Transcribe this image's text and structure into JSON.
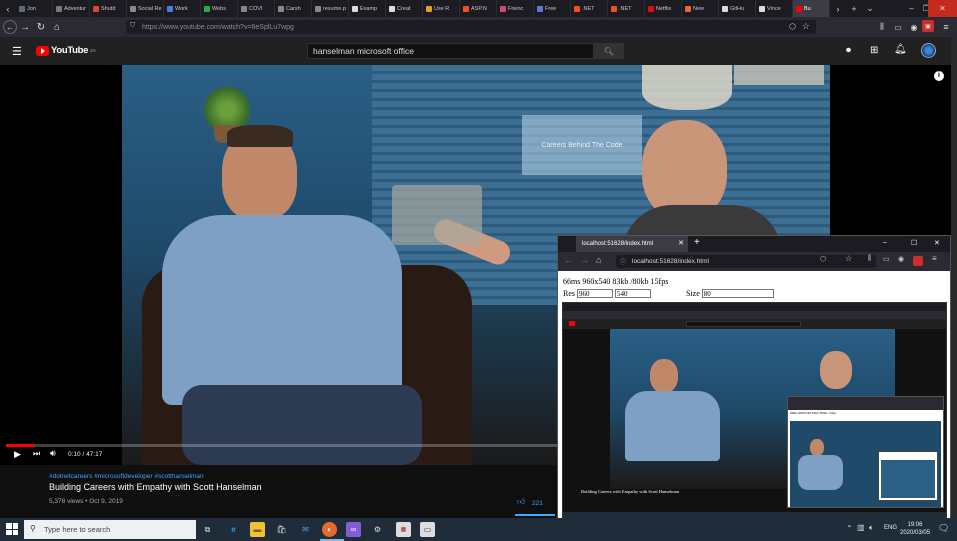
{
  "browser": {
    "tabs": [
      {
        "label": "Jon",
        "color": "#5b6b7a"
      },
      {
        "label": "Adventur",
        "color": "#7a7a7a"
      },
      {
        "label": "Shutd",
        "color": "#d64a2a"
      },
      {
        "label": "Social Re",
        "color": "#8a8a8a"
      },
      {
        "label": "Work",
        "color": "#4a7ed8"
      },
      {
        "label": "Webs",
        "color": "#2aa84a"
      },
      {
        "label": "COVI",
        "color": "#888888"
      },
      {
        "label": "Carsh",
        "color": "#888888"
      },
      {
        "label": "resume.p",
        "color": "#888888"
      },
      {
        "label": "Examp",
        "color": "#dddddd"
      },
      {
        "label": "Creat",
        "color": "#dddddd"
      },
      {
        "label": "Use R",
        "color": "#e0a030"
      },
      {
        "label": "ASP.N",
        "color": "#f25022"
      },
      {
        "label": "Frienc",
        "color": "#d04a6a"
      },
      {
        "label": "Free",
        "color": "#5a7ad8"
      },
      {
        "label": ".NET",
        "color": "#f25022"
      },
      {
        "label": ".NET",
        "color": "#f25022"
      },
      {
        "label": "Netflix",
        "color": "#e50914"
      },
      {
        "label": "New",
        "color": "#e86a2a"
      },
      {
        "label": "GitHu",
        "color": "#dddddd"
      },
      {
        "label": "Vince",
        "color": "#dddddd"
      },
      {
        "label": "Bu",
        "color": "#ff0000",
        "active": true
      }
    ],
    "url": "https://www.youtube.com/watch?v=6eSplLu7wpg",
    "new_tab": "+",
    "dropdown": "⌄",
    "minimize": "–",
    "restore": "❐",
    "close": "✕"
  },
  "youtube": {
    "logo_text": "YouTube",
    "logo_region": "ZA",
    "search_value": "hanselman microsoft office",
    "player": {
      "time": "0:10 / 47:17",
      "progress_fraction": 0.0035
    },
    "hashtags": "#dotnetcareers #microsoftdeveloper #scotthanselman",
    "title": "Building Careers with Empathy with Scott Hanselman",
    "meta": "5,378 views • Oct 9, 2019",
    "like_count": "221",
    "video_overlay_sign": "Careers Behind The Code"
  },
  "popup": {
    "tab_title": "localhost:51628/index.html",
    "url": "localhost:51628/index.html",
    "stats": "66ms 960x540 83kb /80kb 15fps",
    "res_label": "Res",
    "res_w": "960",
    "res_h": "540",
    "size_label": "Size",
    "size_value": "80"
  },
  "mini": {
    "title": "Building Careers with Empathy with Scott Hanselman",
    "inner_stats": "66ms 960x540 83kb /80kb 15fps"
  },
  "taskbar": {
    "search_placeholder": "Type here to search",
    "language": "ENG",
    "time": "19:06",
    "date": "2020/03/05"
  },
  "colors": {
    "youtube_red": "#ff0000",
    "taskbar_bg": "#1f2d3b",
    "link_blue": "#3ea6ff"
  }
}
